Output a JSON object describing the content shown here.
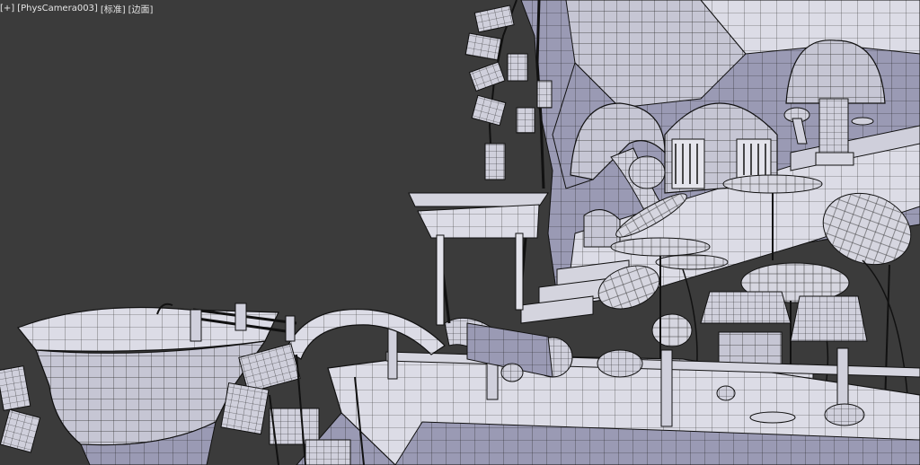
{
  "viewport": {
    "menu_plus": "[+]",
    "camera_label": "[PhysCamera003]",
    "shading_label": "[标准]",
    "display_label": "[边面]"
  },
  "colors": {
    "background": "#3b3b3b",
    "surface": "#c8c8d6",
    "surface_shadow": "#8e8ea8",
    "surface_light": "#e2e2ea",
    "wire": "#1a1a1a"
  }
}
